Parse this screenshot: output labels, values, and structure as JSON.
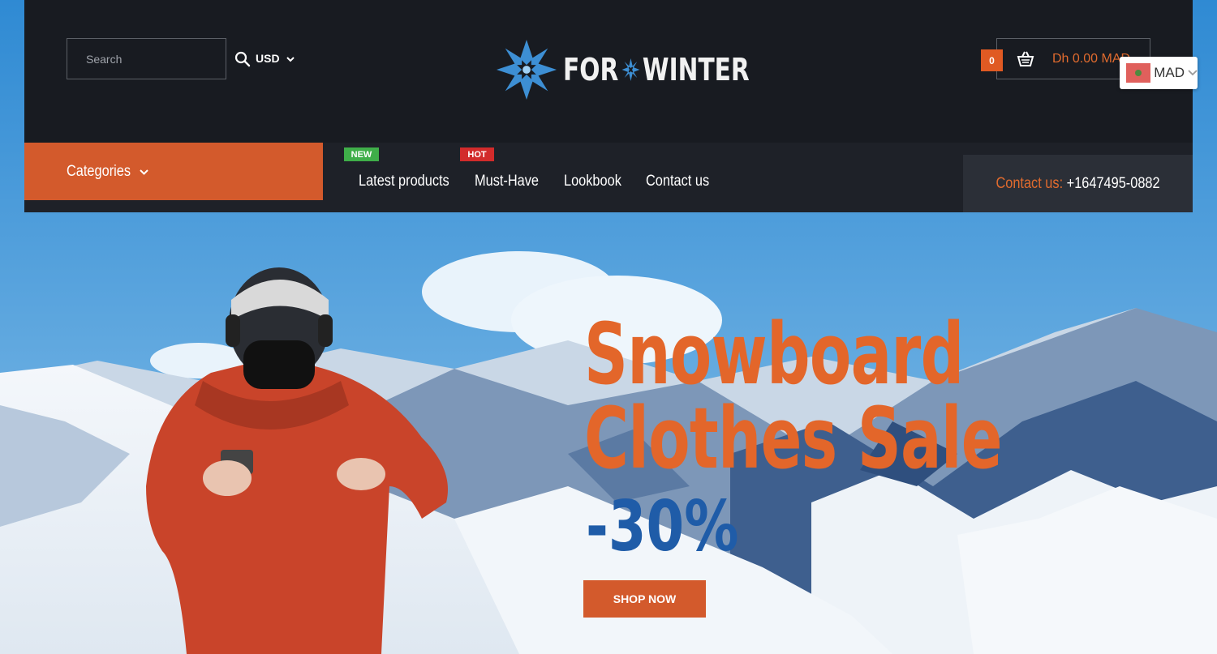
{
  "header": {
    "search": {
      "placeholder": "Search"
    },
    "currency": "USD",
    "logo": {
      "text_left": "FOR",
      "text_right": "WINTER"
    },
    "cart": {
      "count": "0",
      "total": "Dh 0.00 MAD"
    },
    "currency_widget": {
      "code": "MAD"
    }
  },
  "nav": {
    "categories_label": "Categories",
    "items": [
      {
        "label": "Latest products",
        "badge": "NEW"
      },
      {
        "label": "Must-Have",
        "badge": "HOT"
      },
      {
        "label": "Lookbook"
      },
      {
        "label": "Contact us"
      }
    ],
    "contact": {
      "label": "Contact us:",
      "phone": "+1647495-0882"
    }
  },
  "hero": {
    "title_line1": "Snowboard",
    "title_line2": "Clothes Sale",
    "discount": "-30%",
    "cta": "SHOP NOW"
  },
  "colors": {
    "accent": "#d35a2c",
    "header_bg": "#181b21",
    "nav_bg": "#1e2128",
    "discount_blue": "#1f5ca8",
    "badge_new": "#3fae49",
    "badge_hot": "#d22b2b"
  }
}
